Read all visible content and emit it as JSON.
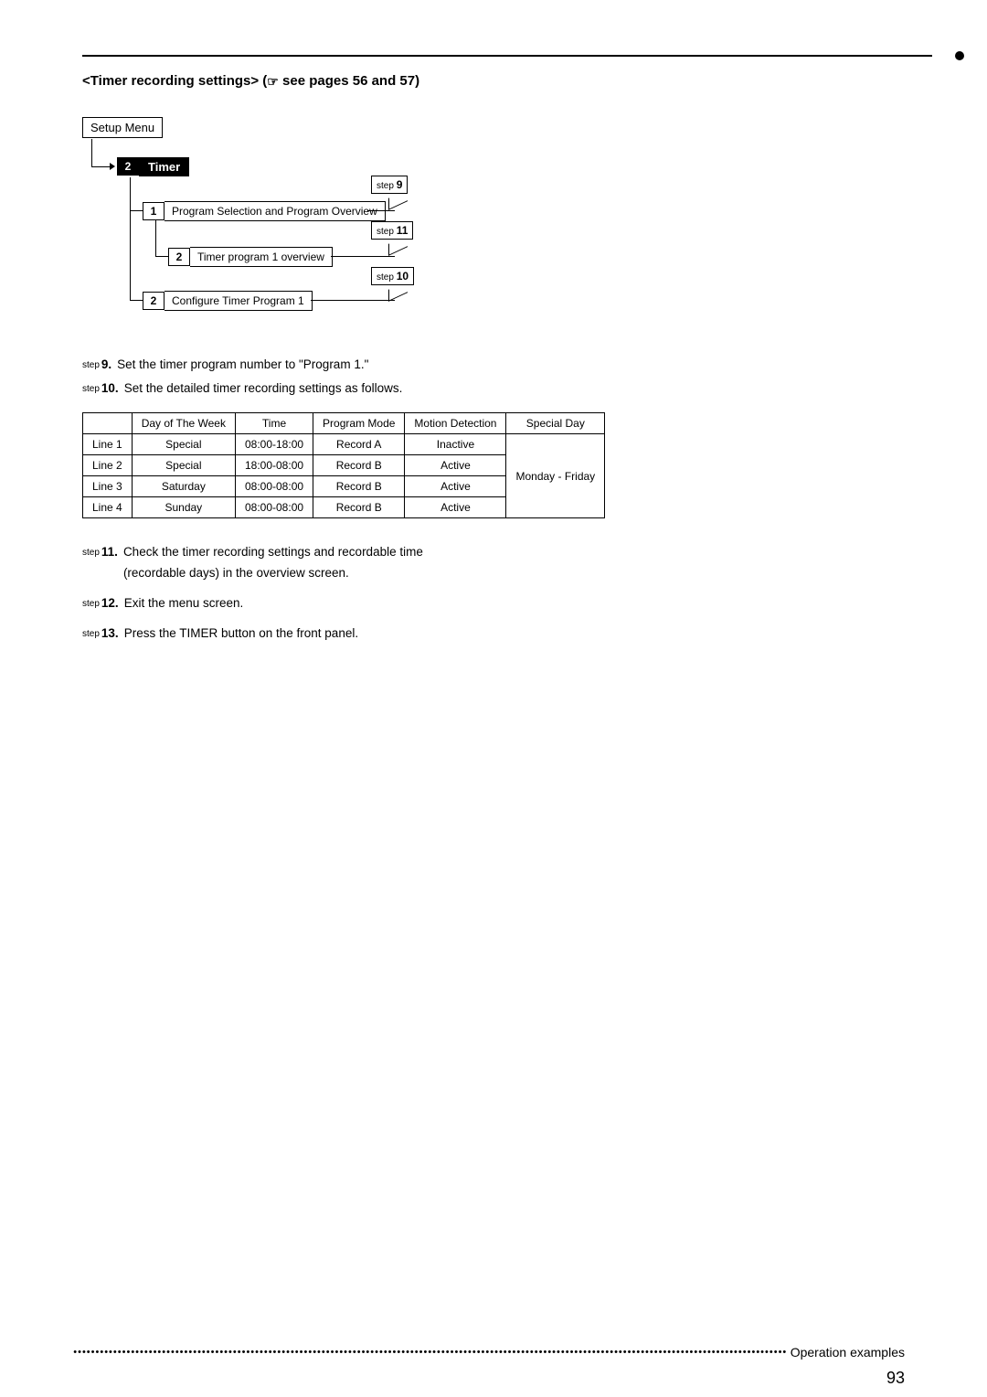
{
  "heading_prefix": "<Timer recording settings> (",
  "heading_suffix": " see pages 56 and 57)",
  "tree": {
    "setup_menu": "Setup Menu",
    "num2": "2",
    "timer": "Timer",
    "item1_num": "1",
    "item1_text": "Program Selection and Program Overview",
    "item2_num": "2",
    "item2_text": "Timer program 1 overview",
    "item3_num": "2",
    "item3_text": "Configure Timer Program 1",
    "step9_lbl": "step",
    "step9_no": "9",
    "step11_lbl": "step",
    "step11_no": "11",
    "step10_lbl": "step",
    "step10_no": "10"
  },
  "steps_a": [
    {
      "lbl": "step",
      "no": "9.",
      "txt": "Set the timer program number to \"Program 1.\""
    },
    {
      "lbl": "step",
      "no": "10.",
      "txt": "Set the detailed timer recording settings as follows."
    }
  ],
  "table": {
    "headers": [
      "",
      "Day of The Week",
      "Time",
      "Program Mode",
      "Motion Detection",
      "Special Day"
    ],
    "rows": [
      [
        "Line 1",
        "Special",
        "08:00-18:00",
        "Record A",
        "Inactive",
        "Monday - Friday"
      ],
      [
        "Line 2",
        "Special",
        "18:00-08:00",
        "Record B",
        "Active",
        ""
      ],
      [
        "Line 3",
        "Saturday",
        "08:00-08:00",
        "Record B",
        "Active",
        ""
      ],
      [
        "Line 4",
        "Sunday",
        "08:00-08:00",
        "Record B",
        "Active",
        ""
      ]
    ]
  },
  "steps_b": [
    {
      "lbl": "step",
      "no": "11.",
      "txt": "Check the timer recording settings and recordable time (recordable days) in the overview screen."
    },
    {
      "lbl": "step",
      "no": "12.",
      "txt": "Exit the menu screen."
    },
    {
      "lbl": "step",
      "no": "13.",
      "txt": "Press the TIMER button on the front panel."
    }
  ],
  "footer_text": "Operation examples",
  "page_number": "93"
}
